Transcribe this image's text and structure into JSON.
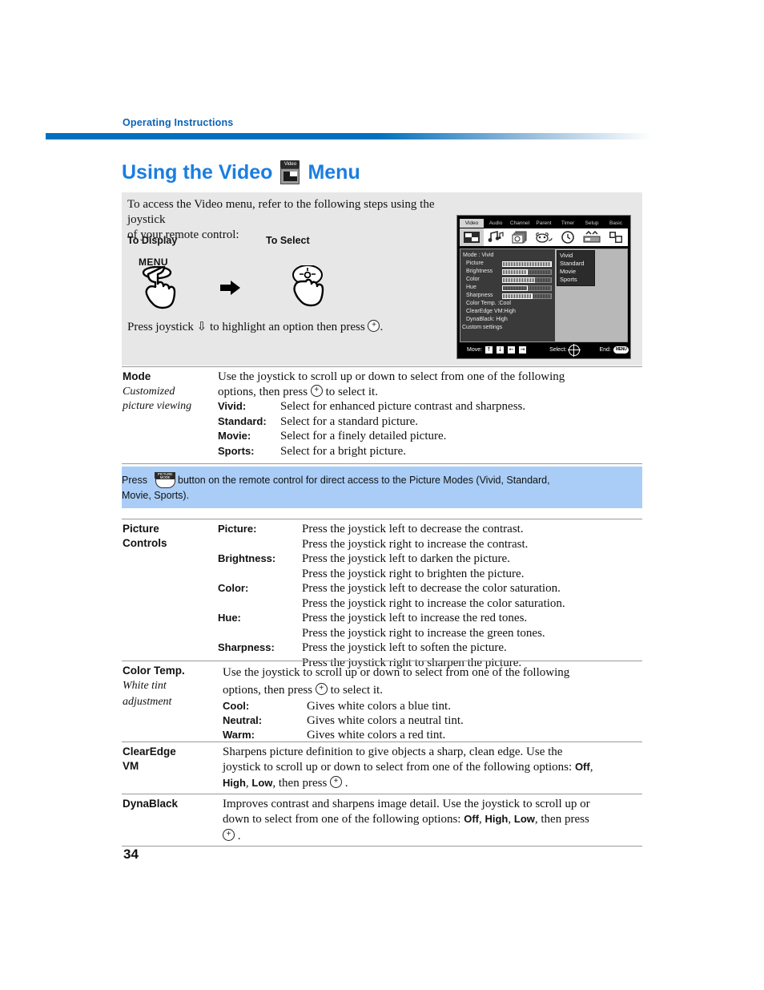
{
  "running_head": "Operating Instructions",
  "page_number": "34",
  "title": {
    "before_icon": "Using the Video",
    "icon_label": "Video",
    "after_icon": "Menu"
  },
  "intro": {
    "line1": "To access the Video menu, refer to the following steps using the joystick",
    "line2": "of your remote control:",
    "col_a_heading": "To Display",
    "col_b_heading": "To Select",
    "menu_button_label": "MENU",
    "press_line_part1": "Press joystick",
    "press_line_arrow": "⇩",
    "press_line_part2": "to highlight an option then press",
    "press_line_end": "."
  },
  "osd": {
    "tabs": [
      "Video",
      "Audio",
      "Channel",
      "Parent",
      "Timer",
      "Setup",
      "Basic"
    ],
    "selected_tab": "Video",
    "mode_header": "Mode : Vivid",
    "sliders": [
      {
        "label": "Picture",
        "fill_pct": 100
      },
      {
        "label": "Brightness",
        "fill_pct": 52
      },
      {
        "label": "Color",
        "fill_pct": 66
      },
      {
        "label": "Hue",
        "fill_pct": 50
      },
      {
        "label": "Sharpness",
        "fill_pct": 62
      }
    ],
    "rows": [
      "Color Temp. :Cool",
      "ClearEdge VM:High",
      "DynaBlack: High"
    ],
    "custom_settings": "Custom settings",
    "popup_options": [
      "Vivid",
      "Standard",
      "Movie",
      "Sports"
    ],
    "popup_selected": "Vivid",
    "footer": {
      "move_label": "Move:",
      "move_keys": [
        "↑",
        "↓",
        "←",
        "→"
      ],
      "select_label": "Select:",
      "end_label": "End:",
      "end_key": "MENU"
    }
  },
  "sections": [
    {
      "term": "Mode",
      "subterm_lines": [
        "Customized",
        "picture viewing"
      ],
      "intro_line1": "Use the joystick to scroll up or down to select from one of the following",
      "intro_line2_a": "options, then press",
      "intro_line2_b": "to select it.",
      "options": [
        {
          "key": "Vivid:",
          "def": "Select for enhanced picture contrast and sharpness."
        },
        {
          "key": "Standard:",
          "def": "Select for a standard picture."
        },
        {
          "key": "Movie:",
          "def": "Select for a finely detailed picture."
        },
        {
          "key": "Sports:",
          "def": "Select for a bright picture."
        }
      ]
    }
  ],
  "note": {
    "press_word": "Press",
    "icon_line1": "PICTURE",
    "icon_line2": "MODE",
    "text_after_icon": "button on the remote control for direct access to the Picture Modes (Vivid, Standard,",
    "line2": "Movie, Sports)."
  },
  "picture_controls": {
    "term_line1": "Picture",
    "term_line2": "Controls",
    "rows": [
      {
        "key": "Picture:",
        "def1": "Press the joystick left to decrease the contrast.",
        "def2": "Press the joystick right to increase the contrast."
      },
      {
        "key": "Brightness:",
        "def1": "Press the joystick left to darken the picture.",
        "def2": "Press the joystick right to brighten the picture."
      },
      {
        "key": "Color:",
        "def1": "Press the joystick left to decrease the color saturation.",
        "def2": "Press the joystick right to increase the color saturation."
      },
      {
        "key": "Hue:",
        "def1": "Press the joystick left to increase the red tones.",
        "def2": "Press the joystick right to increase the green tones."
      },
      {
        "key": "Sharpness:",
        "def1": "Press the joystick left to soften the picture.",
        "def2": "Press the joystick right to sharpen the picture."
      }
    ]
  },
  "color_temp": {
    "term": "Color Temp.",
    "subterm_lines": [
      "White tint",
      "adjustment"
    ],
    "intro_line1": "Use the joystick to scroll up or down to select from one of the following",
    "intro_line2_a": "options, then press",
    "intro_line2_b": "to select it.",
    "options": [
      {
        "key": "Cool:",
        "def": "Gives white colors a blue tint."
      },
      {
        "key": "Neutral:",
        "def": "Gives white colors a neutral tint."
      },
      {
        "key": "Warm:",
        "def": "Gives white colors a red tint."
      }
    ]
  },
  "clearedge": {
    "term_line1": "ClearEdge",
    "term_line2": "VM",
    "line1": "Sharpens picture definition to give objects a sharp, clean edge. Use the",
    "line2_a": "joystick to scroll up or down to select from one of the following options: ",
    "line2_opt": "Off",
    "line2_b": ",",
    "line3_opt1": "High",
    "line3_sep": ", ",
    "line3_opt2": "Low",
    "line3_tail": ", then press",
    "line3_end": "."
  },
  "dynablack": {
    "term": "DynaBlack",
    "line1": "Improves contrast and sharpens image detail. Use the joystick to scroll up or",
    "line2_a": "down to select from one of the following options: ",
    "line2_opt1": "Off",
    "line2_sep1": ", ",
    "line2_opt2": "High",
    "line2_sep2": ", ",
    "line2_opt3": "Low",
    "line2_tail": ", then press",
    "line3_end": "."
  },
  "colors": {
    "brand_blue": "#1a7ee0",
    "rule_blue": "#0271bd",
    "note_blue": "#a9cdf6",
    "panel_gray": "#e7e7e7"
  }
}
